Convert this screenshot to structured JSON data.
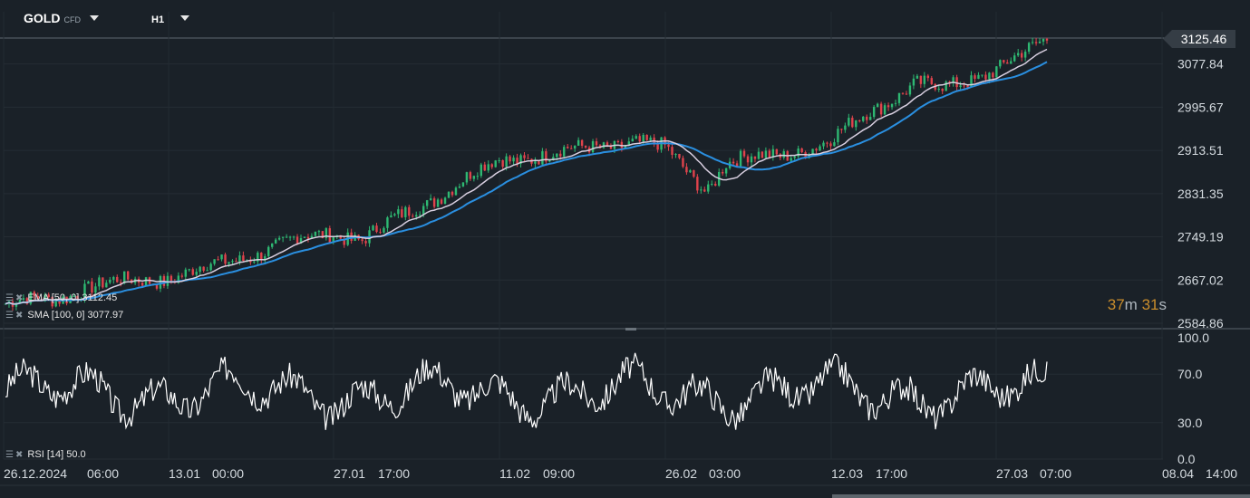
{
  "header": {
    "symbol": "GOLD",
    "symbol_type": "CFD",
    "timeframe": "H1"
  },
  "legend": {
    "ema": "EMA [50, 0] 3112.45",
    "sma": "SMA [100, 0] 3077.97",
    "rsi": "RSI [14] 50.0"
  },
  "timer": {
    "minutes": "37",
    "min_unit": "m",
    "seconds": "31",
    "sec_unit": "s"
  },
  "current_price": "3125.46",
  "colors": {
    "background": "#1a2128",
    "bull": "#2eb872",
    "bear": "#e0434c",
    "ema": "#d8cfe0",
    "sma": "#2a8fe0",
    "rsi": "#ffffff",
    "timer": "#c98d2c"
  },
  "chart_data": [
    {
      "type": "candlestick",
      "series": [
        {
          "name": "EMA [50, 0]",
          "last": 3112.45
        },
        {
          "name": "SMA [100, 0]",
          "last": 3077.97
        }
      ],
      "price_trend": [
        {
          "x": "26.12.2024 06:00",
          "y": 2622
        },
        {
          "x": "13.01 00:00",
          "y": 2672
        },
        {
          "x": "27.01 17:00",
          "y": 2758
        },
        {
          "x": "11.02 09:00",
          "y": 2895
        },
        {
          "x": "26.02 03:00",
          "y": 2915
        },
        {
          "x": "12.03 17:00",
          "y": 2930
        },
        {
          "x": "27.03 07:00",
          "y": 3070
        },
        {
          "x": "last",
          "y": 3125.46
        }
      ],
      "y_ticks": [
        "3125.46",
        "3077.84",
        "2995.67",
        "2913.51",
        "2831.35",
        "2749.19",
        "2667.02",
        "2584.86"
      ],
      "x_ticks": [
        "26.12.2024",
        "06:00",
        "13.01",
        "00:00",
        "27.01",
        "17:00",
        "11.02",
        "09:00",
        "26.02",
        "03:00",
        "12.03",
        "17:00",
        "27.03",
        "07:00",
        "08.04",
        "14:00"
      ],
      "ylim": [
        2584.86,
        3125.46
      ],
      "grid": true
    },
    {
      "type": "line",
      "series": [
        {
          "name": "RSI [14]",
          "last": 50.0
        }
      ],
      "y_ticks": [
        "100.0",
        "70.0",
        "30.0",
        "0.0"
      ],
      "ylim": [
        0,
        100
      ],
      "grid": true
    }
  ]
}
